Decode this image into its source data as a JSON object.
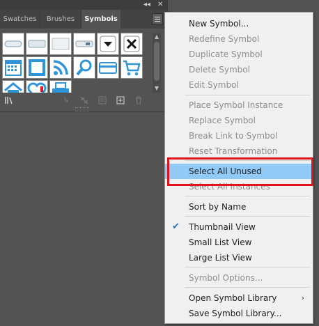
{
  "panel": {
    "tabs": [
      "Swatches",
      "Brushes",
      "Symbols"
    ],
    "active_tab": "Symbols",
    "collapse_glyph": "◂◂",
    "close_glyph": "✕"
  },
  "symbols_grid": [
    "button-rounded-symbol",
    "button-gradient-symbol",
    "button-flat-symbol",
    "button-slider-symbol",
    "dropdown-arrow-symbol",
    "close-x-symbol",
    "calendar-symbol",
    "film-frame-symbol",
    "rss-feed-symbol",
    "magnifier-symbol",
    "credit-card-symbol",
    "shopping-cart-symbol",
    "home-symbol",
    "heart-symbol",
    "printer-symbol"
  ],
  "menu": {
    "items": [
      {
        "label": "New Symbol...",
        "enabled": true
      },
      {
        "label": "Redefine Symbol",
        "enabled": false
      },
      {
        "label": "Duplicate Symbol",
        "enabled": false
      },
      {
        "label": "Delete Symbol",
        "enabled": false
      },
      {
        "label": "Edit Symbol",
        "enabled": false
      },
      {
        "label": "Place Symbol Instance",
        "enabled": false
      },
      {
        "label": "Replace Symbol",
        "enabled": false
      },
      {
        "label": "Break Link to Symbol",
        "enabled": false
      },
      {
        "label": "Reset Transformation",
        "enabled": false
      },
      {
        "label": "Select All Unused",
        "enabled": true,
        "highlighted": true
      },
      {
        "label": "Select All Instances",
        "enabled": false
      },
      {
        "label": "Sort by Name",
        "enabled": true
      },
      {
        "label": "Thumbnail View",
        "enabled": true,
        "checked": true
      },
      {
        "label": "Small List View",
        "enabled": true
      },
      {
        "label": "Large List View",
        "enabled": true
      },
      {
        "label": "Symbol Options...",
        "enabled": false
      },
      {
        "label": "Open Symbol Library",
        "enabled": true,
        "submenu": true
      },
      {
        "label": "Save Symbol Library...",
        "enabled": true
      }
    ]
  },
  "colors": {
    "highlight": "#91c9f7",
    "annotation_box": "#e0121c",
    "symbol_blue": "#2f95d6"
  }
}
